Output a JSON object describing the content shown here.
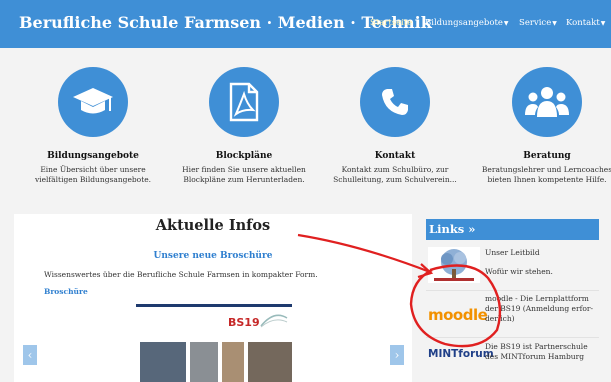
{
  "header": {
    "site_title": "Berufliche Schule Farmsen · Medien · Technik"
  },
  "nav": [
    {
      "label": "Startseite",
      "active": true,
      "dropdown": false
    },
    {
      "label": "Bildungsangebote",
      "active": false,
      "dropdown": true
    },
    {
      "label": "Service",
      "active": false,
      "dropdown": true
    },
    {
      "label": "Kontakt",
      "active": false,
      "dropdown": true
    }
  ],
  "features": [
    {
      "icon": "graduation-cap-icon",
      "title": "Bildungsangebote",
      "desc1": "Eine Übersicht über unsere",
      "desc2": "vielfältigen Bildungsangebote."
    },
    {
      "icon": "pdf-document-icon",
      "title": "Blockpläne",
      "desc1": "Hier finden Sie unsere aktuellen",
      "desc2": "Blockpläne zum Herunterladen."
    },
    {
      "icon": "phone-icon",
      "title": "Kontakt",
      "desc1": "Kontakt zum Schulbüro, zur",
      "desc2": "Schulleitung, zum Schulverein..."
    },
    {
      "icon": "people-group-icon",
      "title": "Beratung",
      "desc1": "Beratungslehrer und Lerncoaches",
      "desc2": "bieten Ihnen kompetente Hilfe."
    }
  ],
  "infos": {
    "title": "Aktuelle Infos",
    "subtitle": "Unsere neue Broschüre",
    "text": "Wissenswertes über die Berufliche Schule Farmsen in kompakter Form.",
    "link": "Broschüre",
    "prev": "‹",
    "next": "›",
    "brochure_logo": "BS19"
  },
  "links": {
    "header": "Links »",
    "items": [
      {
        "line1": "Unser Leitbild",
        "line2": "Wofür wir stehen."
      },
      {
        "logo": "moodle",
        "line1": "moodle - Die Lernplattform",
        "line2": "der BS19 (Anmeldung erfor-",
        "line3": "derlich)"
      },
      {
        "logo": "MINTforum",
        "line1": "Die BS19 ist Partnerschule",
        "line2": "des MINTforum Hamburg"
      }
    ]
  },
  "colors": {
    "primary": "#3f8fd6",
    "annotation": "#e02020",
    "moodle_orange": "#f29100"
  }
}
